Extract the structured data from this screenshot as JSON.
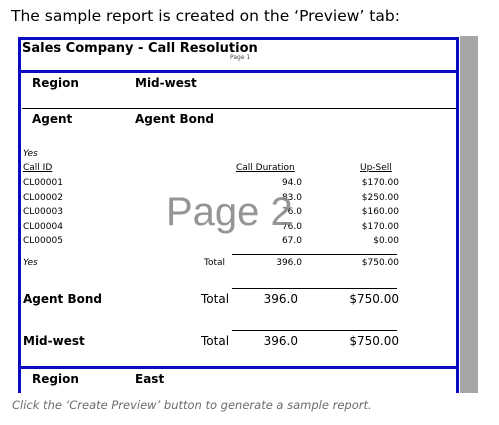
{
  "intro_text": "The sample report is created on the ‘Preview’ tab:",
  "report": {
    "title": "Sales Company - Call Resolution",
    "page_label": "Page 1",
    "region_label": "Region",
    "region_value": "Mid-west",
    "agent_label": "Agent",
    "agent_value": "Agent Bond",
    "flag_top": "Yes",
    "columns": {
      "call_id": "Call ID",
      "call_duration": "Call Duration",
      "up_sell": "Up-Sell"
    },
    "rows": [
      {
        "id": "CL00001",
        "duration": "94.0",
        "upsell": "$170.00"
      },
      {
        "id": "CL00002",
        "duration": "83.0",
        "upsell": "$250.00"
      },
      {
        "id": "CL00003",
        "duration": "76.0",
        "upsell": "$160.00"
      },
      {
        "id": "CL00004",
        "duration": "76.0",
        "upsell": "$170.00"
      },
      {
        "id": "CL00005",
        "duration": "67.0",
        "upsell": "$0.00"
      }
    ],
    "yes_total": {
      "flag": "Yes",
      "label": "Total",
      "duration": "396.0",
      "upsell": "$750.00"
    },
    "agent_total": {
      "name": "Agent Bond",
      "label": "Total",
      "duration": "396.0",
      "upsell": "$750.00"
    },
    "region_total": {
      "name": "Mid-west",
      "label": "Total",
      "duration": "396.0",
      "upsell": "$750.00"
    },
    "next_region_label": "Region",
    "next_region_value": "East"
  },
  "watermark": "Page 2",
  "caption": "Click the ‘Create Preview’ button to generate a sample report.",
  "colors": {
    "border_blue": "#0b0bbf",
    "viewer_gray": "#a6a6a6"
  }
}
